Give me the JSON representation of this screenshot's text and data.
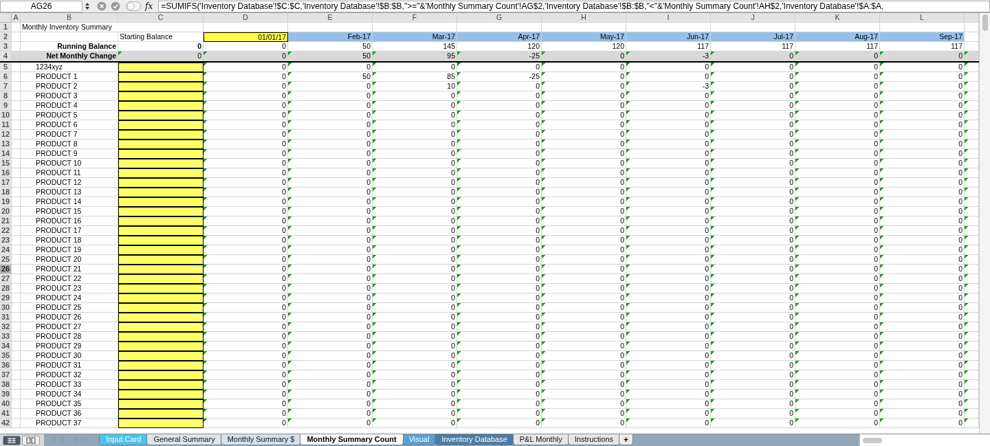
{
  "formula_bar": {
    "cell_reference": "AG26",
    "function_label": "fx",
    "formula": "=SUMIFS('Inventory Database'!$C:$C,'Inventory Database'!$B:$B,\">=\"&'Monthly Summary Count'!AG$2,'Inventory Database'!$B:$B,\"<\"&'Monthly Summary Count'!AH$2,'Inventory Database'!$A:$A,"
  },
  "column_headers": [
    "A",
    "B",
    "C",
    "D",
    "E",
    "F",
    "G",
    "H",
    "I",
    "J",
    "K",
    "L"
  ],
  "sheet": {
    "title": "Monthly Inventory Summary",
    "starting_balance_label": "Starting Balance",
    "start_date": "01/01/17",
    "months": [
      "Feb-17",
      "Mar-17",
      "Apr-17",
      "May-17",
      "Jun-17",
      "Jul-17",
      "Aug-17",
      "Sep-17"
    ],
    "summary_rows": [
      {
        "label": "Running Balance",
        "values": [
          "0",
          "0",
          "50",
          "145",
          "120",
          "120",
          "117",
          "117",
          "117",
          "117"
        ]
      },
      {
        "label": "Net Monthly Change",
        "values": [
          "0",
          "0",
          "50",
          "95",
          "-25",
          "0",
          "-3",
          "0",
          "0",
          "0"
        ]
      }
    ],
    "rows": [
      {
        "name": "1234xyz",
        "values": [
          "0",
          "0",
          "0",
          "0",
          "0",
          "0",
          "0",
          "0",
          "0"
        ]
      },
      {
        "name": "PRODUCT 1",
        "values": [
          "0",
          "50",
          "85",
          "-25",
          "0",
          "0",
          "0",
          "0",
          "0"
        ]
      },
      {
        "name": "PRODUCT 2",
        "values": [
          "0",
          "0",
          "10",
          "0",
          "0",
          "-3",
          "0",
          "0",
          "0"
        ]
      },
      {
        "name": "PRODUCT 3",
        "values": [
          "0",
          "0",
          "0",
          "0",
          "0",
          "0",
          "0",
          "0",
          "0"
        ]
      },
      {
        "name": "PRODUCT 4",
        "values": [
          "0",
          "0",
          "0",
          "0",
          "0",
          "0",
          "0",
          "0",
          "0"
        ]
      },
      {
        "name": "PRODUCT 5",
        "values": [
          "0",
          "0",
          "0",
          "0",
          "0",
          "0",
          "0",
          "0",
          "0"
        ]
      },
      {
        "name": "PRODUCT 6",
        "values": [
          "0",
          "0",
          "0",
          "0",
          "0",
          "0",
          "0",
          "0",
          "0"
        ]
      },
      {
        "name": "PRODUCT 7",
        "values": [
          "0",
          "0",
          "0",
          "0",
          "0",
          "0",
          "0",
          "0",
          "0"
        ]
      },
      {
        "name": "PRODUCT 8",
        "values": [
          "0",
          "0",
          "0",
          "0",
          "0",
          "0",
          "0",
          "0",
          "0"
        ]
      },
      {
        "name": "PRODUCT 9",
        "values": [
          "0",
          "0",
          "0",
          "0",
          "0",
          "0",
          "0",
          "0",
          "0"
        ]
      },
      {
        "name": "PRODUCT 10",
        "values": [
          "0",
          "0",
          "0",
          "0",
          "0",
          "0",
          "0",
          "0",
          "0"
        ]
      },
      {
        "name": "PRODUCT 11",
        "values": [
          "0",
          "0",
          "0",
          "0",
          "0",
          "0",
          "0",
          "0",
          "0"
        ]
      },
      {
        "name": "PRODUCT 12",
        "values": [
          "0",
          "0",
          "0",
          "0",
          "0",
          "0",
          "0",
          "0",
          "0"
        ]
      },
      {
        "name": "PRODUCT 13",
        "values": [
          "0",
          "0",
          "0",
          "0",
          "0",
          "0",
          "0",
          "0",
          "0"
        ]
      },
      {
        "name": "PRODUCT 14",
        "values": [
          "0",
          "0",
          "0",
          "0",
          "0",
          "0",
          "0",
          "0",
          "0"
        ]
      },
      {
        "name": "PRODUCT 15",
        "values": [
          "0",
          "0",
          "0",
          "0",
          "0",
          "0",
          "0",
          "0",
          "0"
        ]
      },
      {
        "name": "PRODUCT 16",
        "values": [
          "0",
          "0",
          "0",
          "0",
          "0",
          "0",
          "0",
          "0",
          "0"
        ]
      },
      {
        "name": "PRODUCT 17",
        "values": [
          "0",
          "0",
          "0",
          "0",
          "0",
          "0",
          "0",
          "0",
          "0"
        ]
      },
      {
        "name": "PRODUCT 18",
        "values": [
          "0",
          "0",
          "0",
          "0",
          "0",
          "0",
          "0",
          "0",
          "0"
        ]
      },
      {
        "name": "PRODUCT 19",
        "values": [
          "0",
          "0",
          "0",
          "0",
          "0",
          "0",
          "0",
          "0",
          "0"
        ]
      },
      {
        "name": "PRODUCT 20",
        "values": [
          "0",
          "0",
          "0",
          "0",
          "0",
          "0",
          "0",
          "0",
          "0"
        ]
      },
      {
        "name": "PRODUCT 21",
        "values": [
          "0",
          "0",
          "0",
          "0",
          "0",
          "0",
          "0",
          "0",
          "0"
        ]
      },
      {
        "name": "PRODUCT 22",
        "values": [
          "0",
          "0",
          "0",
          "0",
          "0",
          "0",
          "0",
          "0",
          "0"
        ]
      },
      {
        "name": "PRODUCT 23",
        "values": [
          "0",
          "0",
          "0",
          "0",
          "0",
          "0",
          "0",
          "0",
          "0"
        ]
      },
      {
        "name": "PRODUCT 24",
        "values": [
          "0",
          "0",
          "0",
          "0",
          "0",
          "0",
          "0",
          "0",
          "0"
        ]
      },
      {
        "name": "PRODUCT 25",
        "values": [
          "0",
          "0",
          "0",
          "0",
          "0",
          "0",
          "0",
          "0",
          "0"
        ]
      },
      {
        "name": "PRODUCT 26",
        "values": [
          "0",
          "0",
          "0",
          "0",
          "0",
          "0",
          "0",
          "0",
          "0"
        ]
      },
      {
        "name": "PRODUCT 27",
        "values": [
          "0",
          "0",
          "0",
          "0",
          "0",
          "0",
          "0",
          "0",
          "0"
        ]
      },
      {
        "name": "PRODUCT 28",
        "values": [
          "0",
          "0",
          "0",
          "0",
          "0",
          "0",
          "0",
          "0",
          "0"
        ]
      },
      {
        "name": "PRODUCT 29",
        "values": [
          "0",
          "0",
          "0",
          "0",
          "0",
          "0",
          "0",
          "0",
          "0"
        ]
      },
      {
        "name": "PRODUCT 30",
        "values": [
          "0",
          "0",
          "0",
          "0",
          "0",
          "0",
          "0",
          "0",
          "0"
        ]
      },
      {
        "name": "PRODUCT 31",
        "values": [
          "0",
          "0",
          "0",
          "0",
          "0",
          "0",
          "0",
          "0",
          "0"
        ]
      },
      {
        "name": "PRODUCT 32",
        "values": [
          "0",
          "0",
          "0",
          "0",
          "0",
          "0",
          "0",
          "0",
          "0"
        ]
      },
      {
        "name": "PRODUCT 33",
        "values": [
          "0",
          "0",
          "0",
          "0",
          "0",
          "0",
          "0",
          "0",
          "0"
        ]
      },
      {
        "name": "PRODUCT 34",
        "values": [
          "0",
          "0",
          "0",
          "0",
          "0",
          "0",
          "0",
          "0",
          "0"
        ]
      },
      {
        "name": "PRODUCT 35",
        "values": [
          "0",
          "0",
          "0",
          "0",
          "0",
          "0",
          "0",
          "0",
          "0"
        ]
      },
      {
        "name": "PRODUCT 36",
        "values": [
          "0",
          "0",
          "0",
          "0",
          "0",
          "0",
          "0",
          "0",
          "0"
        ]
      },
      {
        "name": "PRODUCT 37",
        "values": [
          "0",
          "0",
          "0",
          "0",
          "0",
          "0",
          "0",
          "0",
          "0"
        ]
      }
    ]
  },
  "row_headers": [
    {
      "label": "1",
      "selected": false
    },
    {
      "label": "2",
      "selected": false
    },
    {
      "label": "3",
      "selected": false
    },
    {
      "label": "4",
      "selected": false
    },
    {
      "label": "5",
      "selected": false
    },
    {
      "label": "6",
      "selected": false
    },
    {
      "label": "7",
      "selected": false
    },
    {
      "label": "8",
      "selected": false
    },
    {
      "label": "9",
      "selected": false
    },
    {
      "label": "10",
      "selected": false
    },
    {
      "label": "11",
      "selected": false
    },
    {
      "label": "12",
      "selected": false
    },
    {
      "label": "13",
      "selected": false
    },
    {
      "label": "14",
      "selected": false
    },
    {
      "label": "15",
      "selected": false
    },
    {
      "label": "16",
      "selected": false
    },
    {
      "label": "17",
      "selected": false
    },
    {
      "label": "18",
      "selected": false
    },
    {
      "label": "19",
      "selected": false
    },
    {
      "label": "20",
      "selected": false
    },
    {
      "label": "21",
      "selected": false
    },
    {
      "label": "22",
      "selected": false
    },
    {
      "label": "23",
      "selected": false
    },
    {
      "label": "24",
      "selected": false
    },
    {
      "label": "25",
      "selected": false
    },
    {
      "label": "26",
      "selected": true
    },
    {
      "label": "27",
      "selected": false
    },
    {
      "label": "28",
      "selected": false
    },
    {
      "label": "29",
      "selected": false
    },
    {
      "label": "30",
      "selected": false
    },
    {
      "label": "31",
      "selected": false
    },
    {
      "label": "32",
      "selected": false
    },
    {
      "label": "33",
      "selected": false
    },
    {
      "label": "34",
      "selected": false
    },
    {
      "label": "35",
      "selected": false
    },
    {
      "label": "36",
      "selected": false
    },
    {
      "label": "37",
      "selected": false
    },
    {
      "label": "38",
      "selected": false
    },
    {
      "label": "39",
      "selected": false
    },
    {
      "label": "40",
      "selected": false
    },
    {
      "label": "41",
      "selected": false
    },
    {
      "label": "42",
      "selected": false
    }
  ],
  "sheet_tabs": [
    {
      "label": "Input Card",
      "selected": false,
      "color": "#4cc3ec"
    },
    {
      "label": "General Summary",
      "selected": false,
      "color": "#dce4ec"
    },
    {
      "label": "Monthly Summary $",
      "selected": false,
      "color": "#d4e2ee"
    },
    {
      "label": "Monthly Summary Count",
      "selected": true,
      "color": "#ffffff"
    },
    {
      "label": "Visual",
      "selected": false,
      "color": "#5a9fd4"
    },
    {
      "label": "Inventory Database",
      "selected": false,
      "color": "#4a7ca6"
    },
    {
      "label": "P&L Monthly",
      "selected": false,
      "color": "#e6e6e6"
    },
    {
      "label": "Instructions",
      "selected": false,
      "color": "#e6e6e6"
    }
  ],
  "add_sheet_button": "+"
}
